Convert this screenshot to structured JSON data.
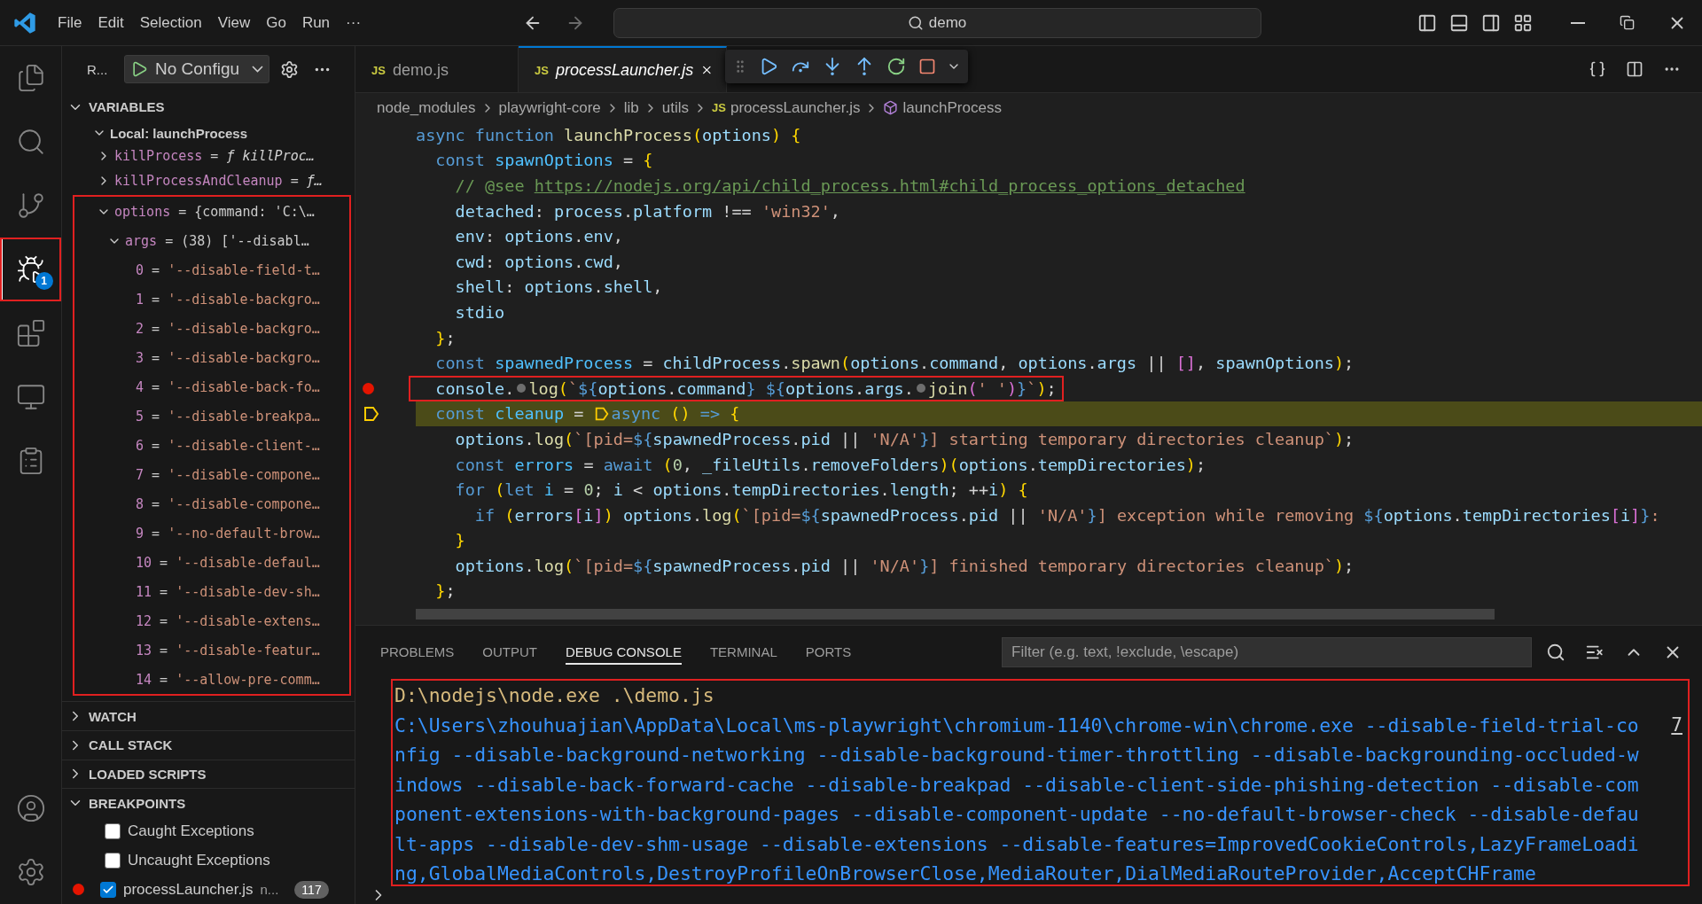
{
  "title_bar": {
    "menus": [
      "File",
      "Edit",
      "Selection",
      "View",
      "Go",
      "Run",
      "···"
    ],
    "search": "demo"
  },
  "activity_bar": {
    "items": [
      {
        "kind": "explorer",
        "selected": false
      },
      {
        "kind": "search",
        "selected": false
      },
      {
        "kind": "scm",
        "selected": false
      },
      {
        "kind": "debug",
        "selected": true,
        "badge": "1",
        "highlighted": true
      },
      {
        "kind": "extensions",
        "selected": false
      },
      {
        "kind": "remote",
        "selected": false
      },
      {
        "kind": "testing",
        "selected": false
      }
    ],
    "bottom": [
      {
        "kind": "accounts"
      },
      {
        "kind": "settings"
      }
    ]
  },
  "sidebar": {
    "title": "R...",
    "config": "No Configu",
    "variables": {
      "title": "VARIABLES",
      "expanded": true,
      "scope": {
        "label": "Local: launchProcess",
        "expanded": true
      },
      "items": [
        {
          "text": "killProcess = ƒ killProc…",
          "kind": "function",
          "expanded": false
        },
        {
          "text": "killProcessAndCleanup = ƒ…",
          "kind": "function",
          "expanded": false
        },
        {
          "text": "options = {command: 'C:\\…",
          "kind": "object",
          "expanded": true,
          "highlighted": true,
          "children": [
            {
              "text": "args = (38) ['--disabl…",
              "kind": "object",
              "expanded": true,
              "children": [
                {
                  "text": "0 = '--disable-field-t…",
                  "kind": "string"
                },
                {
                  "text": "1 = '--disable-backgro…",
                  "kind": "string"
                },
                {
                  "text": "2 = '--disable-backgro…",
                  "kind": "string"
                },
                {
                  "text": "3 = '--disable-backgro…",
                  "kind": "string"
                },
                {
                  "text": "4 = '--disable-back-fo…",
                  "kind": "string"
                },
                {
                  "text": "5 = '--disable-breakpa…",
                  "kind": "string"
                },
                {
                  "text": "6 = '--disable-client-…",
                  "kind": "string"
                },
                {
                  "text": "7 = '--disable-compone…",
                  "kind": "string"
                },
                {
                  "text": "8 = '--disable-compone…",
                  "kind": "string"
                },
                {
                  "text": "9 = '--no-default-brow…",
                  "kind": "string"
                },
                {
                  "text": "10 = '--disable-defaul…",
                  "kind": "string"
                },
                {
                  "text": "11 = '--disable-dev-sh…",
                  "kind": "string"
                },
                {
                  "text": "12 = '--disable-extens…",
                  "kind": "string"
                },
                {
                  "text": "13 = '--disable-featur…",
                  "kind": "string"
                },
                {
                  "text": "14 = '--allow-pre-comm…",
                  "kind": "string"
                }
              ]
            }
          ]
        }
      ]
    },
    "sections": [
      {
        "title": "WATCH",
        "expanded": false
      },
      {
        "title": "CALL STACK",
        "expanded": false
      },
      {
        "title": "LOADED SCRIPTS",
        "expanded": false
      }
    ],
    "breakpoints": {
      "title": "BREAKPOINTS",
      "expanded": true,
      "items": [
        {
          "kind": "exception",
          "label": "Caught Exceptions",
          "checked": false
        },
        {
          "kind": "exception",
          "label": "Uncaught Exceptions",
          "checked": false
        },
        {
          "kind": "file",
          "label": "processLauncher.js",
          "detail": "n...",
          "count": "117",
          "checked": true
        }
      ]
    }
  },
  "editor": {
    "tabs": [
      {
        "file_icon": "JS",
        "label": "demo.js",
        "selected": false,
        "preview": false
      },
      {
        "file_icon": "JS",
        "label": "processLauncher.js",
        "selected": true,
        "preview": true
      }
    ],
    "breadcrumb": [
      {
        "kind": "folder",
        "label": "node_modules"
      },
      {
        "kind": "folder",
        "label": "playwright-core"
      },
      {
        "kind": "folder",
        "label": "lib"
      },
      {
        "kind": "folder",
        "label": "utils"
      },
      {
        "kind": "file",
        "file_icon": "JS",
        "label": "processLauncher.js"
      },
      {
        "kind": "symbol",
        "label": "launchProcess"
      }
    ],
    "lines": [
      {
        "parts": [
          {
            "kind": "text",
            "text": "async function launchProcess(options) {"
          }
        ]
      },
      {
        "parts": [
          {
            "kind": "text",
            "text": "  const spawnOptions = {"
          }
        ]
      },
      {
        "parts": [
          {
            "kind": "text",
            "text": "    // @see https://nodejs.org/api/child_process.html#child_process_options_detached"
          }
        ]
      },
      {
        "parts": [
          {
            "kind": "text",
            "text": "    detached: process.platform !== 'win32',"
          }
        ]
      },
      {
        "parts": [
          {
            "kind": "text",
            "text": "    env: options.env,"
          }
        ]
      },
      {
        "parts": [
          {
            "kind": "text",
            "text": "    cwd: options.cwd,"
          }
        ]
      },
      {
        "parts": [
          {
            "kind": "text",
            "text": "    shell: options.shell,"
          }
        ]
      },
      {
        "parts": [
          {
            "kind": "text",
            "text": "    stdio"
          }
        ]
      },
      {
        "parts": [
          {
            "kind": "text",
            "text": "  };"
          }
        ]
      },
      {
        "parts": [
          {
            "kind": "text",
            "text": "  const spawnedProcess = childProcess.spawn(options.command, options.args || [], spawnOptions);"
          }
        ]
      },
      {
        "breakpoint": true,
        "highlighted": true,
        "parts": [
          {
            "kind": "text",
            "text": "  console."
          },
          {
            "kind": "inline_breakpoint"
          },
          {
            "kind": "text",
            "text": "log(`${options.command} ${options.args."
          },
          {
            "kind": "inline_breakpoint"
          },
          {
            "kind": "text",
            "text": "join(' ')}`);"
          }
        ]
      },
      {
        "current": true,
        "parts": [
          {
            "kind": "text",
            "text": "  const cleanup = "
          },
          {
            "kind": "stack_frame"
          },
          {
            "kind": "text",
            "text": "async () => {"
          }
        ]
      },
      {
        "parts": [
          {
            "kind": "text",
            "text": "    options.log(`[pid=${spawnedProcess.pid || 'N/A'}] starting temporary directories cleanup`);"
          }
        ]
      },
      {
        "parts": [
          {
            "kind": "text",
            "text": "    const errors = await (0, _fileUtils.removeFolders)(options.tempDirectories);"
          }
        ]
      },
      {
        "parts": [
          {
            "kind": "text",
            "text": "    for (let i = 0; i < options.tempDirectories.length; ++i) {"
          }
        ]
      },
      {
        "parts": [
          {
            "kind": "text",
            "text": "      if (errors[i]) options.log(`[pid=${spawnedProcess.pid || 'N/A'}] exception while removing ${options.tempDirectories[i]}:"
          }
        ]
      },
      {
        "parts": [
          {
            "kind": "text",
            "text": "    }"
          }
        ]
      },
      {
        "parts": [
          {
            "kind": "text",
            "text": "    options.log(`[pid=${spawnedProcess.pid || 'N/A'}] finished temporary directories cleanup`);"
          }
        ]
      },
      {
        "parts": [
          {
            "kind": "text",
            "text": "  };"
          }
        ]
      }
    ]
  },
  "panel": {
    "tabs": [
      {
        "label": "PROBLEMS",
        "selected": false
      },
      {
        "label": "OUTPUT",
        "selected": false
      },
      {
        "label": "DEBUG CONSOLE",
        "selected": true
      },
      {
        "label": "TERMINAL",
        "selected": false
      },
      {
        "label": "PORTS",
        "selected": false
      }
    ],
    "filter": {
      "placeholder": "Filter (e.g. text, !exclude, \\escape)"
    },
    "console": {
      "highlighted": true,
      "lines": [
        {
          "kind": "command",
          "text": "D:\\nodejs\\node.exe .\\demo.js"
        },
        {
          "kind": "output",
          "text": "C:\\Users\\zhouhuajian\\AppData\\Local\\ms-playwright\\chromium-1140\\chrome-win\\chrome.exe --disable-field-trial-co",
          "source": "7"
        },
        {
          "kind": "output",
          "text": "nfig --disable-background-networking --disable-background-timer-throttling --disable-backgrounding-occluded-w"
        },
        {
          "kind": "output",
          "text": "indows --disable-back-forward-cache --disable-breakpad --disable-client-side-phishing-detection --disable-com"
        },
        {
          "kind": "output",
          "text": "ponent-extensions-with-background-pages --disable-component-update --no-default-browser-check --disable-defau"
        },
        {
          "kind": "output",
          "text": "lt-apps --disable-dev-shm-usage --disable-extensions --disable-features=ImprovedCookieControls,LazyFrameLoadi"
        },
        {
          "kind": "output",
          "text": "ng,GlobalMediaControls,DestroyProfileOnBrowserClose,MediaRouter,DialMediaRouteProvider,AcceptCHFrame"
        }
      ]
    }
  }
}
